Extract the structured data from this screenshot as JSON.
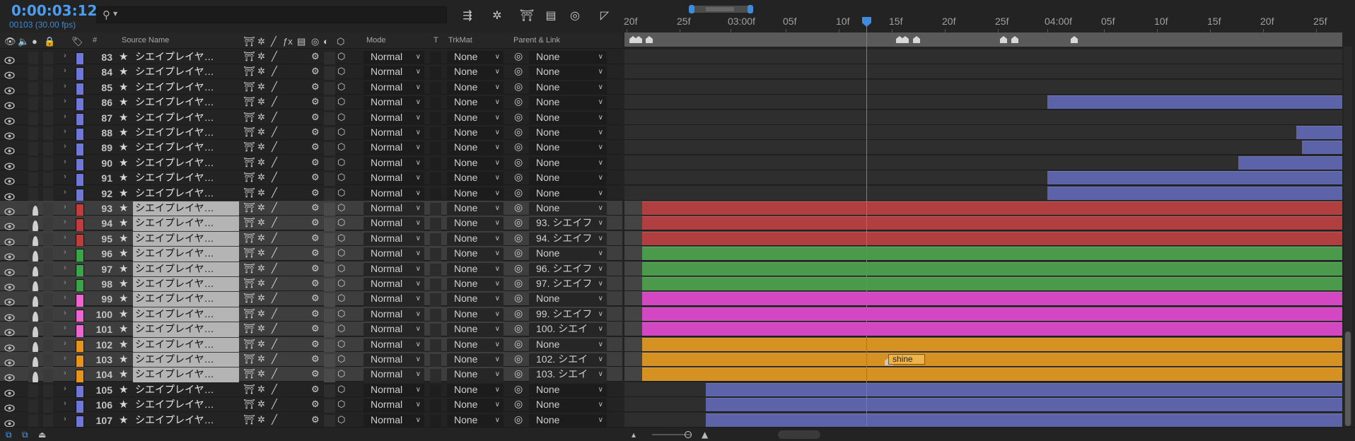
{
  "header": {
    "timecode": "0:00:03:12",
    "subtime": "00103 (30.00 fps)",
    "columns": {
      "hash": "#",
      "source_name": "Source Name",
      "mode": "Mode",
      "t": "T",
      "trkmat": "TrkMat",
      "parent": "Parent & Link"
    }
  },
  "ruler": {
    "labels": [
      "20f",
      "25f",
      "03:00f",
      "05f",
      "10f",
      "15f",
      "20f",
      "25f",
      "04:00f",
      "05f",
      "10f",
      "15f",
      "20f",
      "25f"
    ]
  },
  "layers": [
    {
      "num": "83",
      "name": "シエイプレイヤ…",
      "mode": "Normal",
      "trkmat": "None",
      "parent": "None",
      "color": "#6f77d8",
      "sel": false
    },
    {
      "num": "84",
      "name": "シエイプレイヤ…",
      "mode": "Normal",
      "trkmat": "None",
      "parent": "None",
      "color": "#6f77d8",
      "sel": false
    },
    {
      "num": "85",
      "name": "シエイプレイヤ…",
      "mode": "Normal",
      "trkmat": "None",
      "parent": "None",
      "color": "#6f77d8",
      "sel": false
    },
    {
      "num": "86",
      "name": "シエイプレイヤ…",
      "mode": "Normal",
      "trkmat": "None",
      "parent": "None",
      "color": "#6f77d8",
      "sel": false
    },
    {
      "num": "87",
      "name": "シエイプレイヤ…",
      "mode": "Normal",
      "trkmat": "None",
      "parent": "None",
      "color": "#6f77d8",
      "sel": false
    },
    {
      "num": "88",
      "name": "シエイプレイヤ…",
      "mode": "Normal",
      "trkmat": "None",
      "parent": "None",
      "color": "#6f77d8",
      "sel": false
    },
    {
      "num": "89",
      "name": "シエイプレイヤ…",
      "mode": "Normal",
      "trkmat": "None",
      "parent": "None",
      "color": "#6f77d8",
      "sel": false
    },
    {
      "num": "90",
      "name": "シエイプレイヤ…",
      "mode": "Normal",
      "trkmat": "None",
      "parent": "None",
      "color": "#6f77d8",
      "sel": false
    },
    {
      "num": "91",
      "name": "シエイプレイヤ…",
      "mode": "Normal",
      "trkmat": "None",
      "parent": "None",
      "color": "#6f77d8",
      "sel": false
    },
    {
      "num": "92",
      "name": "シエイプレイヤ…",
      "mode": "Normal",
      "trkmat": "None",
      "parent": "None",
      "color": "#6f77d8",
      "sel": false
    },
    {
      "num": "93",
      "name": "シエイプレイヤ…",
      "mode": "Normal",
      "trkmat": "None",
      "parent": "None",
      "color": "#c33b3b",
      "sel": true
    },
    {
      "num": "94",
      "name": "シエイプレイヤ…",
      "mode": "Normal",
      "trkmat": "None",
      "parent": "93. シエイフ",
      "color": "#c33b3b",
      "sel": true
    },
    {
      "num": "95",
      "name": "シエイプレイヤ…",
      "mode": "Normal",
      "trkmat": "None",
      "parent": "94. シエイフ",
      "color": "#c33b3b",
      "sel": true
    },
    {
      "num": "96",
      "name": "シエイプレイヤ…",
      "mode": "Normal",
      "trkmat": "None",
      "parent": "None",
      "color": "#3aa548",
      "sel": true
    },
    {
      "num": "97",
      "name": "シエイプレイヤ…",
      "mode": "Normal",
      "trkmat": "None",
      "parent": "96. シエイフ",
      "color": "#3aa548",
      "sel": true
    },
    {
      "num": "98",
      "name": "シエイプレイヤ…",
      "mode": "Normal",
      "trkmat": "None",
      "parent": "97. シエイフ",
      "color": "#3aa548",
      "sel": true
    },
    {
      "num": "99",
      "name": "シエイプレイヤ…",
      "mode": "Normal",
      "trkmat": "None",
      "parent": "None",
      "color": "#ef63d3",
      "sel": true
    },
    {
      "num": "100",
      "name": "シエイプレイヤ…",
      "mode": "Normal",
      "trkmat": "None",
      "parent": "99. シエイフ",
      "color": "#ef63d3",
      "sel": true
    },
    {
      "num": "101",
      "name": "シエイプレイヤ…",
      "mode": "Normal",
      "trkmat": "None",
      "parent": "100. シエイ",
      "color": "#ef63d3",
      "sel": true
    },
    {
      "num": "102",
      "name": "シエイプレイヤ…",
      "mode": "Normal",
      "trkmat": "None",
      "parent": "None",
      "color": "#e8941c",
      "sel": true
    },
    {
      "num": "103",
      "name": "シエイプレイヤ…",
      "mode": "Normal",
      "trkmat": "None",
      "parent": "102. シエイ",
      "color": "#e8941c",
      "sel": true
    },
    {
      "num": "104",
      "name": "シエイプレイヤ…",
      "mode": "Normal",
      "trkmat": "None",
      "parent": "103. シエイ",
      "color": "#e8941c",
      "sel": true
    },
    {
      "num": "105",
      "name": "シエイプレイヤ…",
      "mode": "Normal",
      "trkmat": "None",
      "parent": "None",
      "color": "#6f77d8",
      "sel": false
    },
    {
      "num": "106",
      "name": "シエイプレイヤ…",
      "mode": "Normal",
      "trkmat": "None",
      "parent": "None",
      "color": "#6f77d8",
      "sel": false
    },
    {
      "num": "107",
      "name": "シエイプレイヤ…",
      "mode": "Normal",
      "trkmat": "None",
      "parent": "None",
      "color": "#6f77d8",
      "sel": false
    }
  ],
  "marker_label": "shine",
  "colors": {
    "accent": "#3c8dde",
    "blue_bar": "#5c63a8",
    "red_bar": "#b23f3f",
    "green_bar": "#4b9a4b",
    "pink_bar": "#d447c2",
    "orange_bar": "#d59222"
  }
}
